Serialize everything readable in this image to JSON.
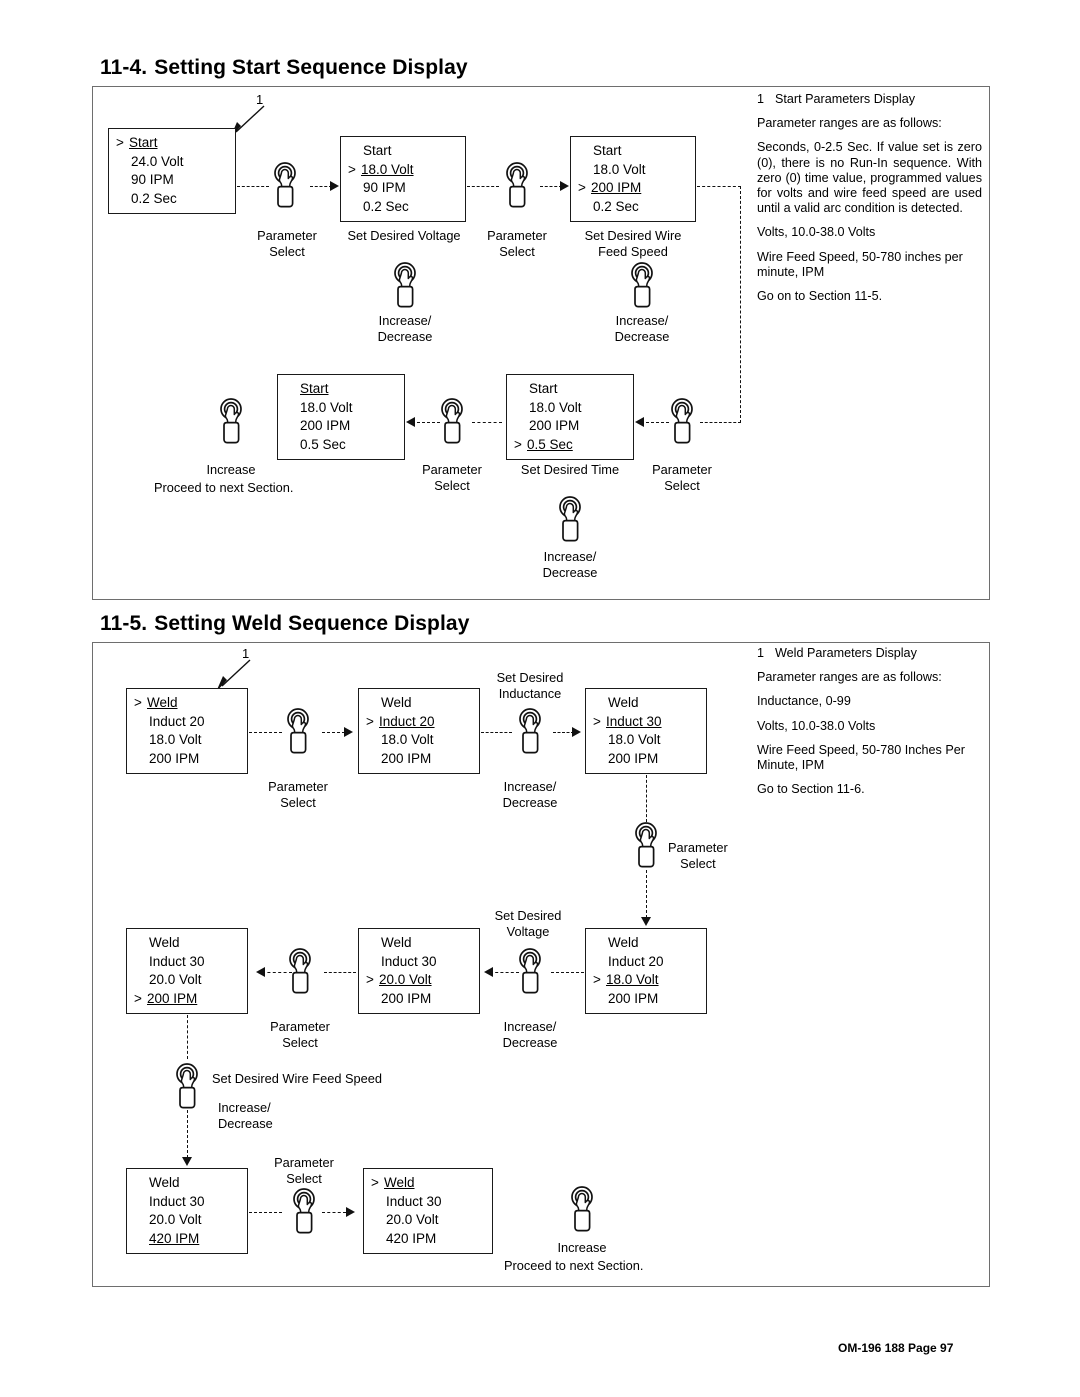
{
  "footer": "OM-196 188 Page 97",
  "sections": [
    {
      "id": "start",
      "number": "11-4.",
      "title": "Setting Start Sequence Display",
      "callout": "1",
      "boxes": [
        {
          "id": "s1",
          "rows": [
            {
              "caret": ">",
              "text": "Start",
              "underline": true
            },
            {
              "caret": "",
              "text": "24.0 Volt",
              "underline": false
            },
            {
              "caret": "",
              "text": "90 IPM",
              "underline": false
            },
            {
              "caret": "",
              "text": "0.2 Sec",
              "underline": false
            }
          ]
        },
        {
          "id": "s2",
          "rows": [
            {
              "caret": "",
              "text": "Start",
              "underline": false
            },
            {
              "caret": ">",
              "text": "18.0 Volt",
              "underline": true
            },
            {
              "caret": "",
              "text": "90 IPM",
              "underline": false
            },
            {
              "caret": "",
              "text": "0.2 Sec",
              "underline": false
            }
          ]
        },
        {
          "id": "s3",
          "rows": [
            {
              "caret": "",
              "text": "Start",
              "underline": false
            },
            {
              "caret": "",
              "text": "18.0 Volt",
              "underline": false
            },
            {
              "caret": ">",
              "text": "200 IPM",
              "underline": true
            },
            {
              "caret": "",
              "text": "0.2 Sec",
              "underline": false
            }
          ]
        },
        {
          "id": "s4",
          "rows": [
            {
              "caret": "",
              "text": "Start",
              "underline": false
            },
            {
              "caret": "",
              "text": "18.0 Volt",
              "underline": false
            },
            {
              "caret": "",
              "text": "200 IPM",
              "underline": false
            },
            {
              "caret": ">",
              "text": "0.5 Sec",
              "underline": true
            }
          ]
        },
        {
          "id": "s5",
          "rows": [
            {
              "caret": "",
              "text": "Start",
              "underline": true
            },
            {
              "caret": "",
              "text": "18.0 Volt",
              "underline": false
            },
            {
              "caret": "",
              "text": "200 IPM",
              "underline": false
            },
            {
              "caret": "",
              "text": "0.5 Sec",
              "underline": false
            }
          ]
        }
      ],
      "captions": {
        "param_select_1": "Parameter\nSelect",
        "set_voltage": "Set Desired Voltage",
        "param_select_2": "Parameter\nSelect",
        "set_wfs": "Set Desired Wire\nFeed Speed",
        "incdec_1": "Increase/\nDecrease",
        "incdec_2": "Increase/\nDecrease",
        "param_select_3": "Parameter\nSelect",
        "set_time": "Set Desired Time",
        "param_select_4": "Parameter\nSelect",
        "incdec_3": "Increase/\nDecrease",
        "increase_final": "Increase",
        "proceed": "Proceed to next Section."
      },
      "note": {
        "item_num": "1",
        "item_label": "Start Parameters Display",
        "lines": [
          "Parameter ranges are as follows:",
          "Seconds, 0-2.5 Sec. If value set is zero (0), there is no Run-In sequence. With zero (0) time value, programmed values for volts and wire feed speed are used until a valid arc condition is detected.",
          "Volts, 10.0-38.0 Volts",
          "Wire Feed Speed, 50-780 inches per minute, IPM",
          "Go on to Section 11-5."
        ]
      }
    },
    {
      "id": "weld",
      "number": "11-5.",
      "title": "Setting Weld Sequence Display",
      "callout": "1",
      "boxes": [
        {
          "id": "w1",
          "rows": [
            {
              "caret": ">",
              "text": "Weld",
              "underline": true
            },
            {
              "caret": "",
              "text": "Induct 20",
              "underline": false
            },
            {
              "caret": "",
              "text": "18.0 Volt",
              "underline": false
            },
            {
              "caret": "",
              "text": "200 IPM",
              "underline": false
            }
          ]
        },
        {
          "id": "w2",
          "rows": [
            {
              "caret": "",
              "text": "Weld",
              "underline": false
            },
            {
              "caret": ">",
              "text": "Induct 20",
              "underline": true
            },
            {
              "caret": "",
              "text": "18.0 Volt",
              "underline": false
            },
            {
              "caret": "",
              "text": "200 IPM",
              "underline": false
            }
          ]
        },
        {
          "id": "w3",
          "rows": [
            {
              "caret": "",
              "text": "Weld",
              "underline": false
            },
            {
              "caret": ">",
              "text": "Induct 30",
              "underline": true
            },
            {
              "caret": "",
              "text": "18.0 Volt",
              "underline": false
            },
            {
              "caret": "",
              "text": "200 IPM",
              "underline": false
            }
          ]
        },
        {
          "id": "w4",
          "rows": [
            {
              "caret": "",
              "text": "Weld",
              "underline": false
            },
            {
              "caret": "",
              "text": "Induct 20",
              "underline": false
            },
            {
              "caret": ">",
              "text": "18.0 Volt",
              "underline": true
            },
            {
              "caret": "",
              "text": "200 IPM",
              "underline": false
            }
          ]
        },
        {
          "id": "w5",
          "rows": [
            {
              "caret": "",
              "text": "Weld",
              "underline": false
            },
            {
              "caret": "",
              "text": "Induct 30",
              "underline": false
            },
            {
              "caret": ">",
              "text": "20.0 Volt",
              "underline": true
            },
            {
              "caret": "",
              "text": "200 IPM",
              "underline": false
            }
          ]
        },
        {
          "id": "w6",
          "rows": [
            {
              "caret": "",
              "text": "Weld",
              "underline": false
            },
            {
              "caret": "",
              "text": "Induct 30",
              "underline": false
            },
            {
              "caret": "",
              "text": "20.0 Volt",
              "underline": false
            },
            {
              "caret": ">",
              "text": "200 IPM",
              "underline": true
            }
          ]
        },
        {
          "id": "w7",
          "rows": [
            {
              "caret": "",
              "text": "Weld",
              "underline": false
            },
            {
              "caret": "",
              "text": "Induct 30",
              "underline": false
            },
            {
              "caret": "",
              "text": "20.0 Volt",
              "underline": false
            },
            {
              "caret": "",
              "text": "420 IPM",
              "underline": true
            }
          ]
        },
        {
          "id": "w8",
          "rows": [
            {
              "caret": ">",
              "text": "Weld",
              "underline": true
            },
            {
              "caret": "",
              "text": "Induct 30",
              "underline": false
            },
            {
              "caret": "",
              "text": "20.0 Volt",
              "underline": false
            },
            {
              "caret": "",
              "text": "420 IPM",
              "underline": false
            }
          ]
        }
      ],
      "captions": {
        "param_select_1": "Parameter\nSelect",
        "set_inductance": "Set Desired\nInductance",
        "incdec_1": "Increase/\nDecrease",
        "param_select_2": "Parameter\nSelect",
        "set_voltage": "Set Desired\nVoltage",
        "incdec_2": "Increase/\nDecrease",
        "param_select_3": "Parameter\nSelect",
        "set_wfs": "Set Desired Wire Feed Speed",
        "incdec_3": "Increase/\nDecrease",
        "param_select_4": "Parameter\nSelect",
        "increase_final": "Increase",
        "proceed": "Proceed to next Section."
      },
      "note": {
        "item_num": "1",
        "item_label": "Weld Parameters Display",
        "lines": [
          "Parameter ranges are as follows:",
          "Inductance, 0-99",
          "Volts, 10.0-38.0 Volts",
          "Wire Feed Speed, 50-780 Inches Per Minute, IPM",
          "Go to Section 11-6."
        ]
      }
    }
  ]
}
